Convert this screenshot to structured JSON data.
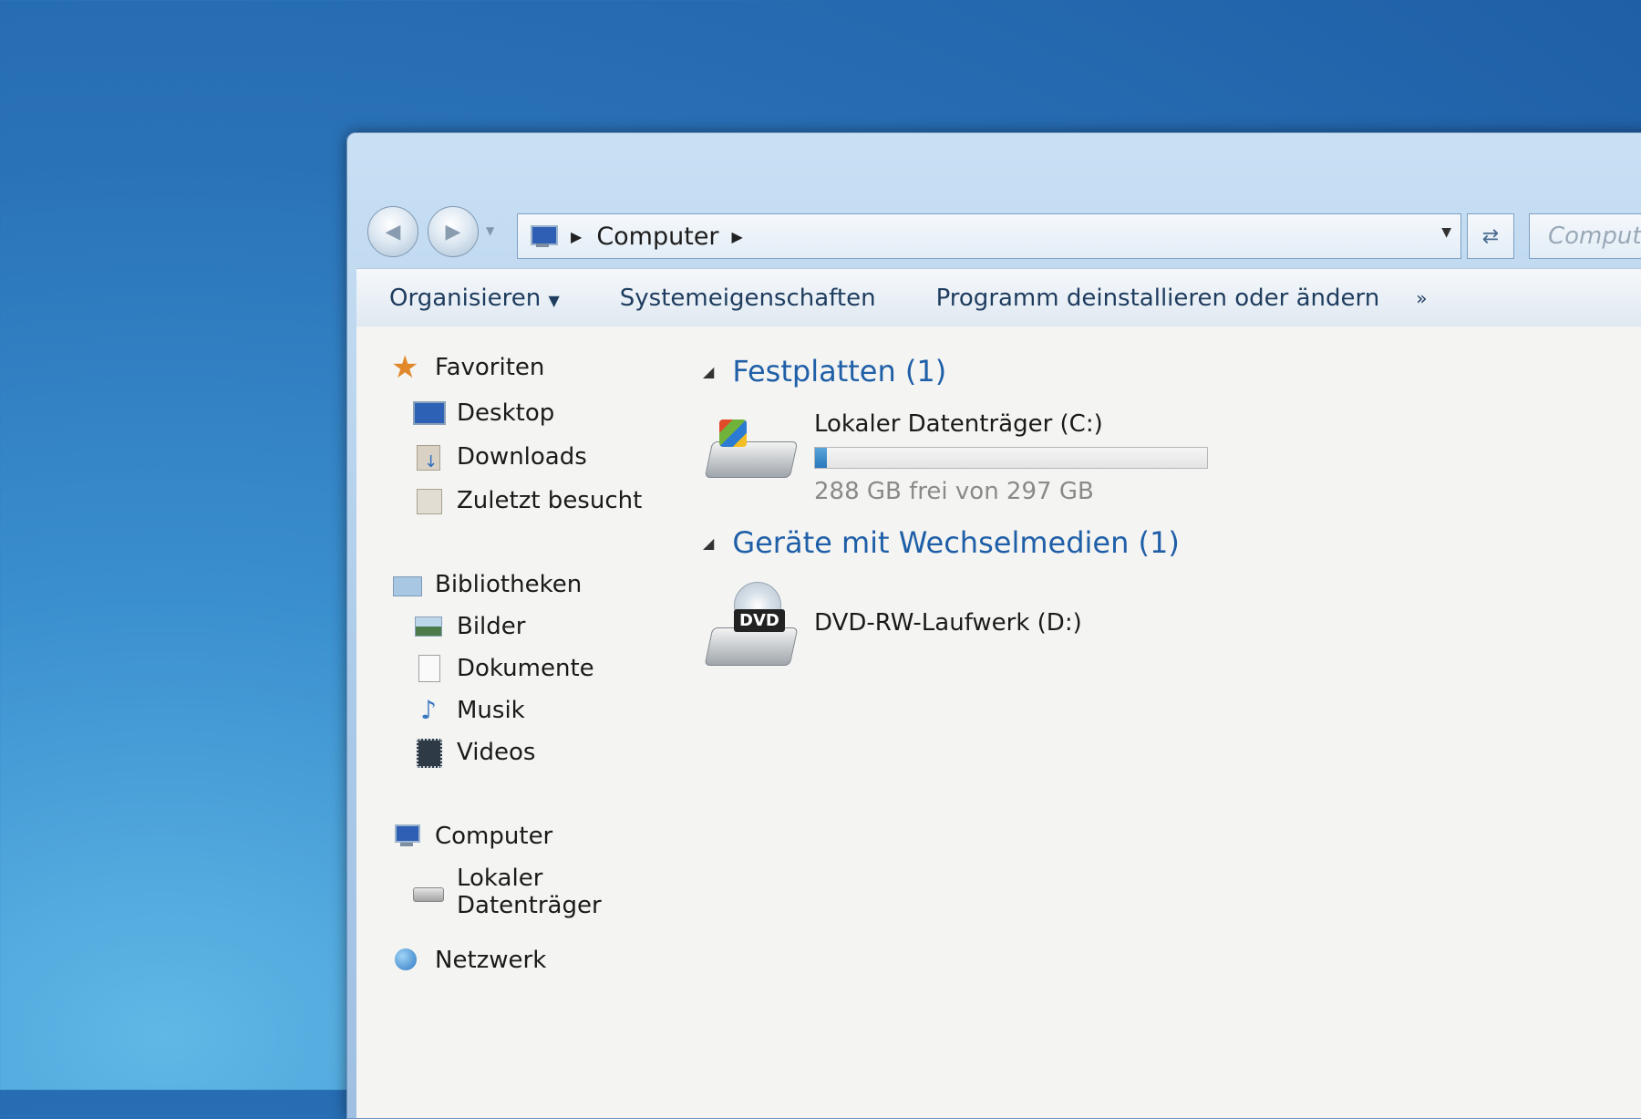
{
  "address": {
    "path_item": "Computer",
    "search_placeholder": "Compute"
  },
  "toolbar": {
    "organize": "Organisieren",
    "system_properties": "Systemeigenschaften",
    "uninstall": "Programm deinstallieren oder ändern",
    "more": "»"
  },
  "nav": {
    "favorites": "Favoriten",
    "desktop": "Desktop",
    "downloads": "Downloads",
    "recent": "Zuletzt besucht",
    "libraries": "Bibliotheken",
    "pictures": "Bilder",
    "documents": "Dokumente",
    "music": "Musik",
    "videos": "Videos",
    "computer": "Computer",
    "local_disk": "Lokaler Datenträger",
    "network": "Netzwerk"
  },
  "groups": {
    "hard_disks": "Festplatten (1)",
    "removable": "Geräte mit Wechselmedien (1)"
  },
  "drives": {
    "c_name": "Lokaler Datenträger (C:)",
    "c_info": "288 GB frei von 297 GB",
    "c_used_fraction": 0.03,
    "d_name": "DVD-RW-Laufwerk (D:)",
    "dvd_label": "DVD"
  }
}
